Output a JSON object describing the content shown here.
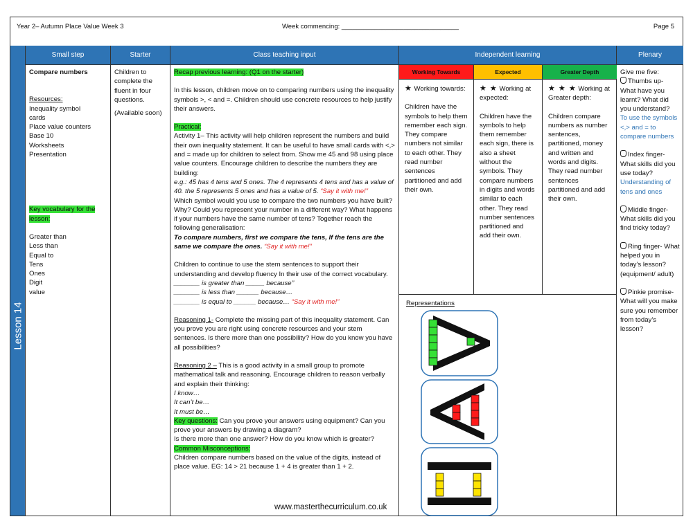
{
  "header": {
    "title": "Year 2– Autumn Place Value Week 3",
    "week": "Week commencing: ________________________________",
    "page": "Page 5"
  },
  "lesson_label": "Lesson 14",
  "columns": {
    "small_step": "Small step",
    "starter": "Starter",
    "teaching": "Class teaching input",
    "independent": "Independent learning",
    "plenary": "Plenary"
  },
  "small_step": {
    "title": "Compare numbers",
    "resources_heading": "Resources:",
    "resources": [
      "Inequality symbol",
      "cards",
      "Place value counters",
      "Base 10",
      "Worksheets",
      "Presentation"
    ],
    "vocab_heading": "Key vocabulary for the lesson:",
    "vocab": [
      "Greater than",
      "Less than",
      "Equal to",
      "Tens",
      "Ones",
      "Digit",
      "value"
    ]
  },
  "starter": {
    "text": "Children to complete the fluent in four questions.",
    "note": "(Available soon)"
  },
  "teaching": {
    "recap": "Recap previous learning: (Q1 on the starter)",
    "intro": "In this lesson, children move on to  comparing numbers using  the inequality symbols >, < and =. Children should use concrete resources to help justify their answers.",
    "practical_label": "Practical:",
    "activity": "Activity 1– This activity will help children  represent the numbers and build their own inequality statement.  It can be useful to have small cards with <,> and = made up for children to select from. Show me 45 and 98 using place value counters.  Encourage children to describe the numbers they are building:",
    "example": "e.g.:  45 has 4 tens and 5 ones.  The 4 represents 4 tens and has a value of 40.  the 5 represents 5 ones and has a value of 5.",
    "say_it": "“Say it with me!”",
    "questions": "Which symbol would you use to compare the two numbers you have built?  Why? Could you represent your number in a  different way? What happens if your numbers have the same number of tens?  Together reach the following generalisation:",
    "generalisation": "To compare numbers, first we compare the tens, If the tens are the same we compare the ones.",
    "stem_intro": " Children to continue to use the stem sentences to support their understanding and develop fluency In their use of the correct vocabulary.",
    "stem1": "_______ is greater than _____  because’’",
    "stem2": "_______ is less than ______  because…",
    "stem3": "_______ is equal to ______ because…",
    "r1_label": "Reasoning 1-",
    "r1_text": " Complete the missing part of this inequality statement.  Can you prove you are right using concrete resources and your stem sentences.  Is there more than one possibility?  How do you know you have all possibilities?",
    "r2_label": "Reasoning  2 –",
    "r2_text": " This is a good  activity in a small group to promote mathematical talk and reasoning.  Encourage children to reason verbally and explain their thinking:",
    "know": "I know…",
    "cant": "It can’t be…",
    "must": "It must be…",
    "kq_label": "Key questions:",
    "kq_text": " Can you prove your answers using equipment? Can you prove your answers by drawing a diagram?",
    "kq_text2": "Is there more than one answer? How do you know which is greater?",
    "misc_label": " Common Misconceptions:",
    "misc_text": "Children compare numbers based on the value of the digits, instead of place value. EG: 14 > 21 because 1 + 4 is greater than 1 + 2."
  },
  "independent": {
    "wt_label": "Working Towards",
    "exp_label": "Expected",
    "gd_label": "Greater Depth",
    "wt_head": "Working towards:",
    "wt_text": "Children have the symbols to help them remember each sign. They compare numbers not similar to each other. They read number sentences partitioned and add their own.",
    "exp_head": "Working at expected:",
    "exp_text": "Children have the symbols to help them remember each sign, there is also a sheet without the symbols. They compare numbers in digits and words similar to each other. They read number sentences partitioned and add their own.",
    "gd_head": "Working at Greater depth:",
    "gd_text": "Children compare numbers as number sentences, partitioned, money and written and words and digits. They read number sentences partitioned and add their own.",
    "representations": "Representations",
    "stars": [
      "★",
      "★ ★",
      "★ ★ ★"
    ],
    "colors": {
      "wt": "#ff1a1a",
      "exp": "#ffc000",
      "gd": "#17b24a"
    }
  },
  "plenary": {
    "intro": "Give me five:",
    "thumb": "Thumbs up- What have you learnt? What did you understand?",
    "thumb_ans": "To use the symbols <,> and = to compare numbers",
    "index": "Index finger- What skills did you use today?",
    "index_ans": "Understanding of tens and ones",
    "middle": "Middle finger- What skills did you find tricky today?",
    "ring": "Ring finger- What helped you in today’s lesson? (equipment/ adult)",
    "pinkie": "Pinkie promise- What will you make sure you remember from today’s lesson?"
  },
  "footer": "www.masterthecurriculum.co.uk"
}
